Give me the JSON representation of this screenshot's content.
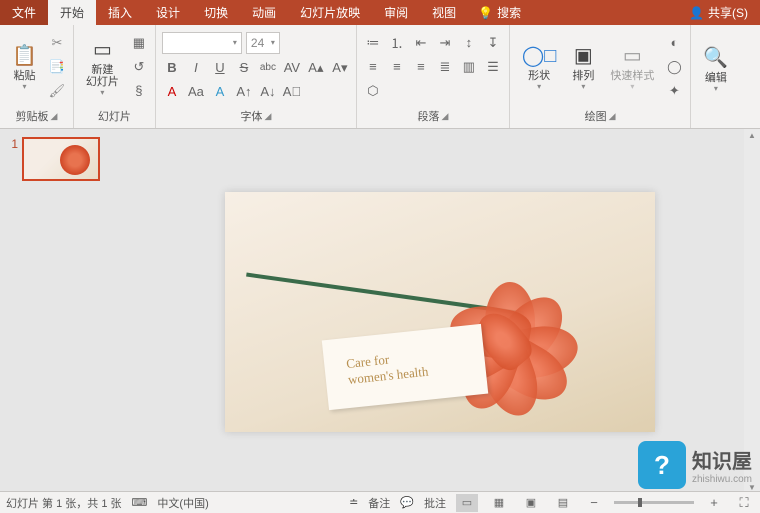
{
  "tabs": {
    "file": "文件",
    "home": "开始",
    "insert": "插入",
    "design": "设计",
    "transitions": "切换",
    "animations": "动画",
    "slideshow": "幻灯片放映",
    "review": "审阅",
    "view": "视图"
  },
  "tellme": "搜索",
  "share": "共享(S)",
  "ribbon": {
    "clipboard": {
      "paste": "粘贴",
      "label": "剪贴板"
    },
    "slides": {
      "newSlide": "新建\n幻灯片",
      "label": "幻灯片"
    },
    "font": {
      "size": "24",
      "label": "字体"
    },
    "paragraph": {
      "label": "段落"
    },
    "drawing": {
      "shapes": "形状",
      "arrange": "排列",
      "quickstyle": "快速样式",
      "label": "绘图"
    },
    "editing": {
      "edit": "编辑"
    }
  },
  "thumbnails": {
    "num1": "1"
  },
  "slide": {
    "cardLine1": "Care for",
    "cardLine2": "women's health"
  },
  "status": {
    "slideinfo": "幻灯片 第 1 张，共 1 张",
    "lang": "中文(中国)",
    "notes": "备注",
    "comments": "批注"
  },
  "watermark": {
    "main": "知识屋",
    "sub": "zhishiwu.com"
  }
}
